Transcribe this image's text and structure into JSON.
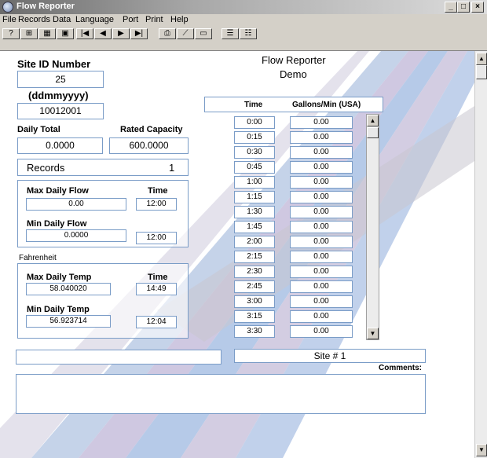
{
  "window": {
    "title": "Flow Reporter",
    "minimize": "_",
    "maximize": "□",
    "close": "×"
  },
  "menu": [
    "File",
    "Records",
    "Data",
    "Language",
    "Port",
    "Print",
    "Help"
  ],
  "toolbar": [
    {
      "icon": "help-icon",
      "glyph": "?"
    },
    {
      "icon": "grid-icon",
      "glyph": "⊞"
    },
    {
      "icon": "chart-icon",
      "glyph": "▦"
    },
    {
      "icon": "window-icon",
      "glyph": "▣"
    },
    {
      "icon": "first-record-icon",
      "glyph": "|◀"
    },
    {
      "icon": "previous-record-icon",
      "glyph": "◀"
    },
    {
      "icon": "next-record-icon",
      "glyph": "▶"
    },
    {
      "icon": "last-record-icon",
      "glyph": "▶|"
    },
    {
      "icon": "printer-icon",
      "glyph": "⎙"
    },
    {
      "icon": "graph-line-icon",
      "glyph": "⟋"
    },
    {
      "icon": "folder-icon",
      "glyph": "▭"
    },
    {
      "icon": "list-view-icon",
      "glyph": "☰"
    },
    {
      "icon": "detail-view-icon",
      "glyph": "☷"
    }
  ],
  "header": {
    "app_name": "Flow Reporter",
    "mode": "Demo"
  },
  "site": {
    "id_label": "Site ID Number",
    "id_value": "25",
    "date_format_label": "(ddmmyyyy)",
    "date_value": "10012001"
  },
  "totals": {
    "daily_total_label": "Daily Total",
    "daily_total_value": "0.0000",
    "rated_capacity_label": "Rated Capacity",
    "rated_capacity_value": "600.0000"
  },
  "records": {
    "label": "Records",
    "count": "1"
  },
  "flow": {
    "max_label": "Max Daily Flow",
    "time_label": "Time",
    "max_value": "0.00",
    "max_time": "12:00",
    "min_label": "Min Daily Flow",
    "min_value": "0.0000",
    "min_time": "12:00"
  },
  "temperature": {
    "unit_label": "Fahrenheit",
    "max_label": "Max Daily Temp",
    "time_label": "Time",
    "max_value": "58.040020",
    "max_time": "14:49",
    "min_label": "Min Daily Temp",
    "min_value": "56.923714",
    "min_time": "12:04"
  },
  "table": {
    "headers": {
      "time": "Time",
      "gallons": "Gallons/Min (USA)"
    },
    "rows": [
      {
        "time": "0:00",
        "value": "0.00"
      },
      {
        "time": "0:15",
        "value": "0.00"
      },
      {
        "time": "0:30",
        "value": "0.00"
      },
      {
        "time": "0:45",
        "value": "0.00"
      },
      {
        "time": "1:00",
        "value": "0.00"
      },
      {
        "time": "1:15",
        "value": "0.00"
      },
      {
        "time": "1:30",
        "value": "0.00"
      },
      {
        "time": "1:45",
        "value": "0.00"
      },
      {
        "time": "2:00",
        "value": "0.00"
      },
      {
        "time": "2:15",
        "value": "0.00"
      },
      {
        "time": "2:30",
        "value": "0.00"
      },
      {
        "time": "2:45",
        "value": "0.00"
      },
      {
        "time": "3:00",
        "value": "0.00"
      },
      {
        "time": "3:15",
        "value": "0.00"
      },
      {
        "time": "3:30",
        "value": "0.00"
      }
    ]
  },
  "bottom": {
    "left_field_value": "",
    "site_name": "Site # 1",
    "comments_label": "Comments:",
    "comments_value": ""
  }
}
